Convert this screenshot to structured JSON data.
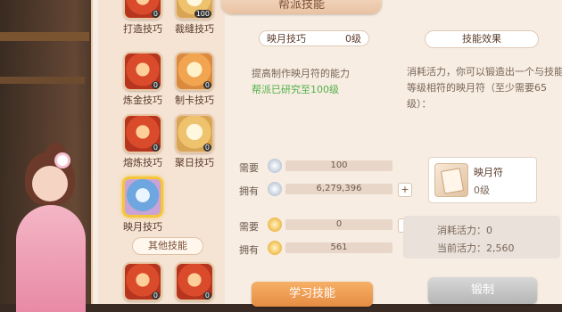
{
  "title": "帮派技能",
  "skills": {
    "top": [
      {
        "label": "打造技巧",
        "count": "0"
      },
      {
        "label": "裁缝技巧",
        "count": "100"
      }
    ],
    "row2": [
      {
        "label": "炼金技巧",
        "count": "0"
      },
      {
        "label": "制卡技巧",
        "count": "0"
      }
    ],
    "row3": [
      {
        "label": "熔炼技巧",
        "count": "0"
      },
      {
        "label": "聚日技巧",
        "count": "0"
      }
    ],
    "row4": [
      {
        "label": "映月技巧",
        "count": ""
      }
    ],
    "other_title": "其他技能",
    "bottom": [
      {
        "label": "",
        "count": "0"
      },
      {
        "label": "",
        "count": "0"
      }
    ]
  },
  "middle": {
    "skill_name": "映月技巧",
    "skill_level": "0级",
    "desc": "提高制作映月符的能力",
    "research": "帮派已研究至100级",
    "need1_label": "需要",
    "need1_value": "100",
    "have1_label": "拥有",
    "have1_value": "6,279,396",
    "plus_text": "+",
    "need2_label": "需要",
    "need2_value": "0",
    "info_text": "i",
    "have2_label": "拥有",
    "have2_value": "561",
    "learn_button": "学习技能"
  },
  "right": {
    "effect_title": "技能效果",
    "effect_desc": "消耗活力，你可以锻造出一个与技能等级相符的映月符（至少需要65级）：",
    "item_name": "映月符",
    "item_level": "0级",
    "consume": "消耗活力：0",
    "current": "当前活力：2,560",
    "forge_button": "锻制"
  },
  "colors": {
    "accent": "#e78c43",
    "research_green": "#52b04a",
    "selected_border": "#f5c53c"
  }
}
